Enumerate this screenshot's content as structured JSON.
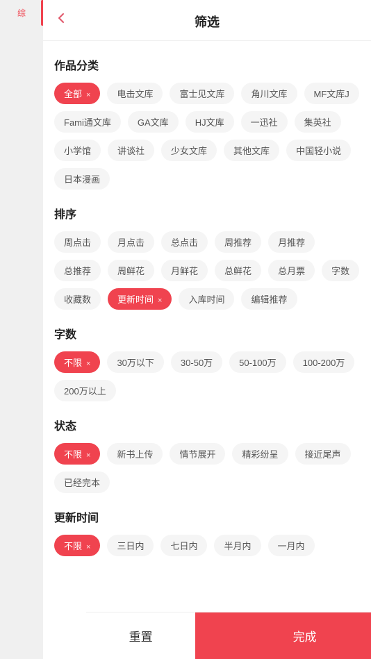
{
  "header": {
    "title": "筛选",
    "back_label": "‹"
  },
  "sidebar": {
    "active_tab": "综"
  },
  "sections": {
    "category": {
      "title": "作品分类",
      "tags": [
        {
          "label": "全部",
          "active": true,
          "closeable": true
        },
        {
          "label": "电击文库",
          "active": false,
          "closeable": false
        },
        {
          "label": "富士见文库",
          "active": false,
          "closeable": false
        },
        {
          "label": "角川文库",
          "active": false,
          "closeable": false
        },
        {
          "label": "MF文库J",
          "active": false,
          "closeable": false
        },
        {
          "label": "Fami通文库",
          "active": false,
          "closeable": false
        },
        {
          "label": "GA文库",
          "active": false,
          "closeable": false
        },
        {
          "label": "HJ文库",
          "active": false,
          "closeable": false
        },
        {
          "label": "一迅社",
          "active": false,
          "closeable": false
        },
        {
          "label": "集英社",
          "active": false,
          "closeable": false
        },
        {
          "label": "小学馆",
          "active": false,
          "closeable": false
        },
        {
          "label": "讲谈社",
          "active": false,
          "closeable": false
        },
        {
          "label": "少女文库",
          "active": false,
          "closeable": false
        },
        {
          "label": "其他文库",
          "active": false,
          "closeable": false
        },
        {
          "label": "中国轻小说",
          "active": false,
          "closeable": false
        },
        {
          "label": "日本漫画",
          "active": false,
          "closeable": false
        }
      ]
    },
    "sort": {
      "title": "排序",
      "tags": [
        {
          "label": "周点击",
          "active": false,
          "closeable": false
        },
        {
          "label": "月点击",
          "active": false,
          "closeable": false
        },
        {
          "label": "总点击",
          "active": false,
          "closeable": false
        },
        {
          "label": "周推荐",
          "active": false,
          "closeable": false
        },
        {
          "label": "月推荐",
          "active": false,
          "closeable": false
        },
        {
          "label": "总推荐",
          "active": false,
          "closeable": false
        },
        {
          "label": "周鲜花",
          "active": false,
          "closeable": false
        },
        {
          "label": "月鲜花",
          "active": false,
          "closeable": false
        },
        {
          "label": "总鲜花",
          "active": false,
          "closeable": false
        },
        {
          "label": "总月票",
          "active": false,
          "closeable": false
        },
        {
          "label": "字数",
          "active": false,
          "closeable": false
        },
        {
          "label": "收藏数",
          "active": false,
          "closeable": false
        },
        {
          "label": "更新时间",
          "active": true,
          "closeable": true
        },
        {
          "label": "入库时间",
          "active": false,
          "closeable": false
        },
        {
          "label": "编辑推荐",
          "active": false,
          "closeable": false
        }
      ]
    },
    "word_count": {
      "title": "字数",
      "tags": [
        {
          "label": "不限",
          "active": true,
          "closeable": true
        },
        {
          "label": "30万以下",
          "active": false,
          "closeable": false
        },
        {
          "label": "30-50万",
          "active": false,
          "closeable": false
        },
        {
          "label": "50-100万",
          "active": false,
          "closeable": false
        },
        {
          "label": "100-200万",
          "active": false,
          "closeable": false
        },
        {
          "label": "200万以上",
          "active": false,
          "closeable": false
        }
      ]
    },
    "status": {
      "title": "状态",
      "tags": [
        {
          "label": "不限",
          "active": true,
          "closeable": true
        },
        {
          "label": "新书上传",
          "active": false,
          "closeable": false
        },
        {
          "label": "情节展开",
          "active": false,
          "closeable": false
        },
        {
          "label": "精彩纷呈",
          "active": false,
          "closeable": false
        },
        {
          "label": "接近尾声",
          "active": false,
          "closeable": false
        },
        {
          "label": "已经完本",
          "active": false,
          "closeable": false
        }
      ]
    },
    "update_time": {
      "title": "更新时间",
      "tags": [
        {
          "label": "不限",
          "active": true,
          "closeable": true
        },
        {
          "label": "三日内",
          "active": false,
          "closeable": false
        },
        {
          "label": "七日内",
          "active": false,
          "closeable": false
        },
        {
          "label": "半月内",
          "active": false,
          "closeable": false
        },
        {
          "label": "一月内",
          "active": false,
          "closeable": false
        }
      ]
    }
  },
  "bottom": {
    "reset_label": "重置",
    "confirm_label": "完成"
  },
  "close_symbol": "×"
}
